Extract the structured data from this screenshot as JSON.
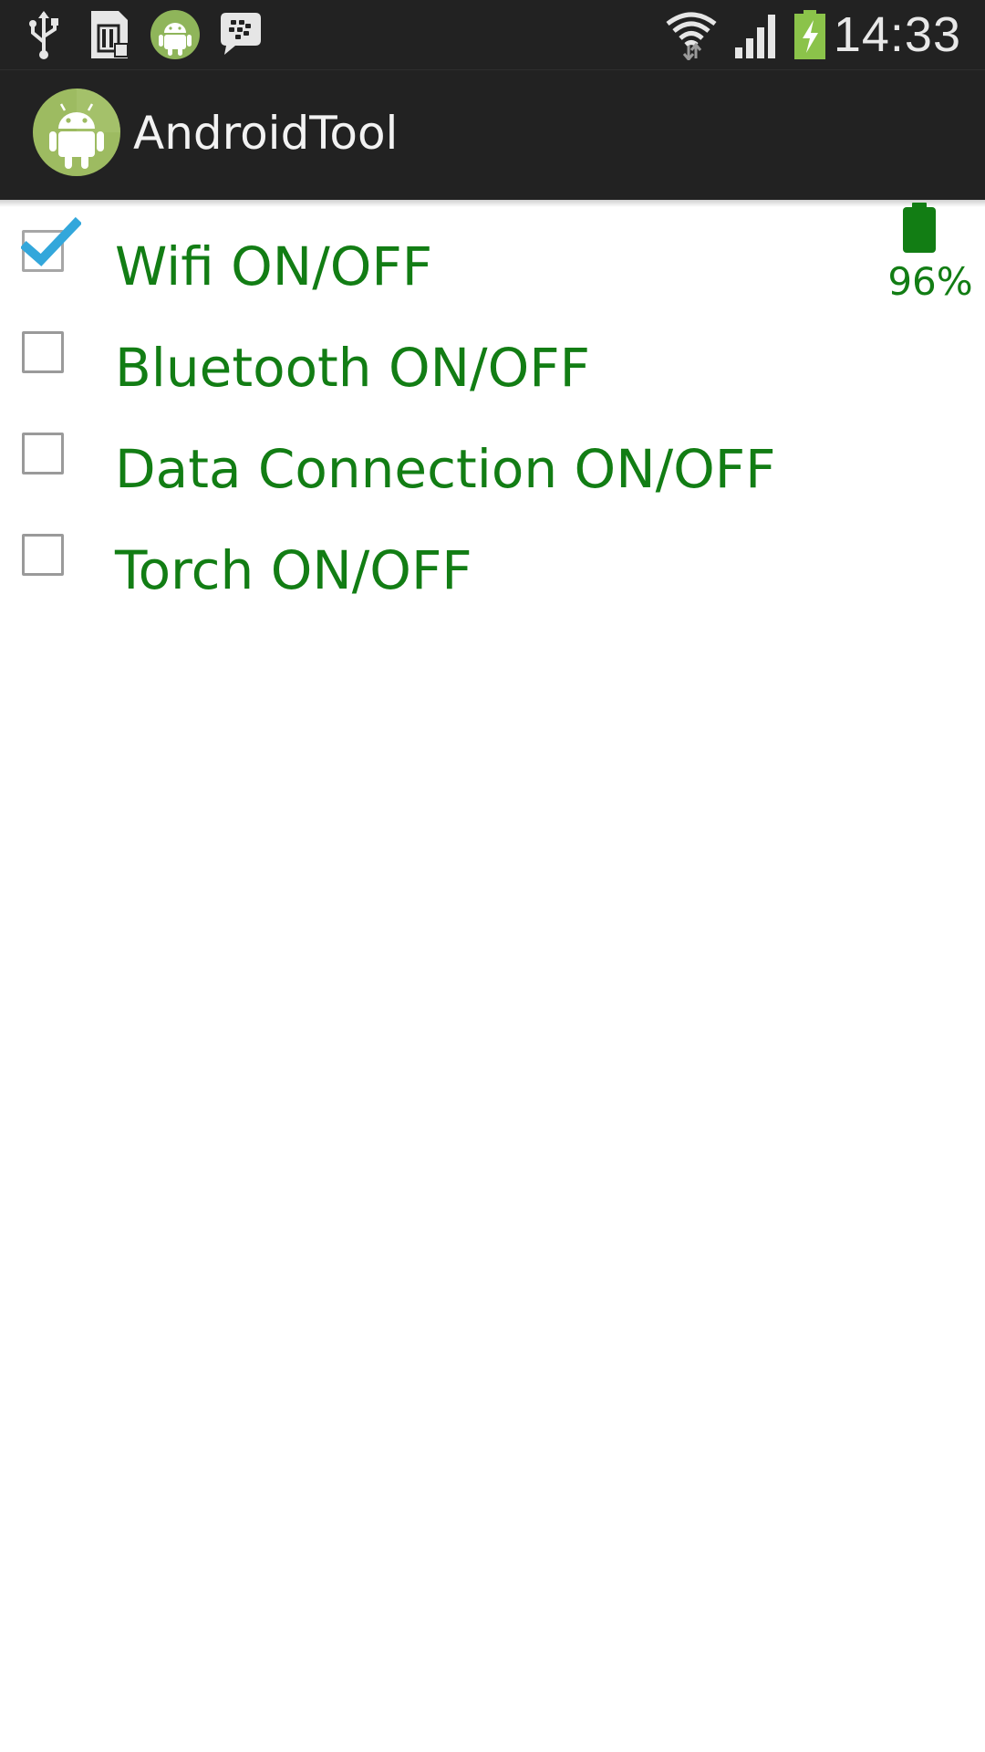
{
  "status_bar": {
    "time": "14:33",
    "icons": [
      "usb-icon",
      "sd-card-icon",
      "android-notification-icon",
      "bbm-icon",
      "wifi-icon",
      "signal-icon",
      "battery-charging-icon"
    ],
    "battery_accent": "#8bc34a"
  },
  "action_bar": {
    "title": "AndroidTool",
    "icon": "android-app-icon",
    "background": "#222222"
  },
  "toggles": [
    {
      "label": "Wifi ON/OFF",
      "checked": true
    },
    {
      "label": "Bluetooth ON/OFF",
      "checked": false
    },
    {
      "label": "Data Connection ON/OFF",
      "checked": false
    },
    {
      "label": "Torch ON/OFF",
      "checked": false
    }
  ],
  "battery_widget": {
    "percent_text": "96%",
    "level": 0.96,
    "icon": "battery-icon"
  },
  "colors": {
    "label_green": "#127d14",
    "checkmark_blue": "#33a7db",
    "bar_dark": "#222222"
  }
}
